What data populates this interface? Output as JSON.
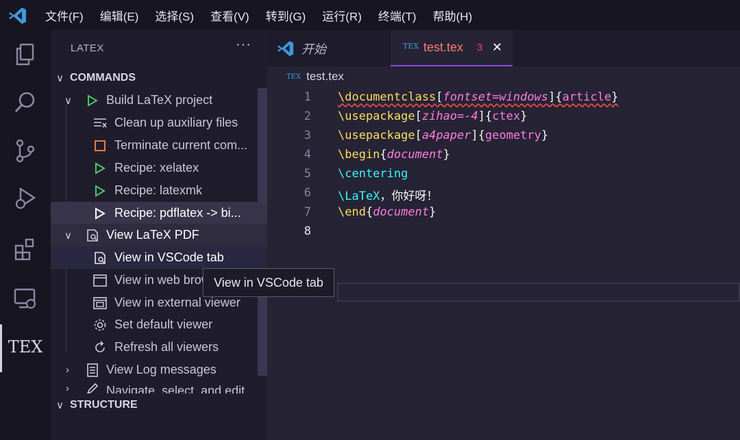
{
  "menu": [
    "文件(F)",
    "编辑(E)",
    "选择(S)",
    "查看(V)",
    "转到(G)",
    "运行(R)",
    "终端(T)",
    "帮助(H)"
  ],
  "activity": {
    "tex_label": "TEX"
  },
  "sidebar": {
    "title": "LATEX",
    "more": "···",
    "commands_header": "COMMANDS",
    "structure_header": "STRUCTURE",
    "items": [
      {
        "label": "Build LaTeX project"
      },
      {
        "label": "Clean up auxiliary files"
      },
      {
        "label": "Terminate current com..."
      },
      {
        "label": "Recipe: xelatex"
      },
      {
        "label": "Recipe: latexmk"
      },
      {
        "label": "Recipe: pdflatex -> bi..."
      },
      {
        "label": "View LaTeX PDF"
      },
      {
        "label": "View in VSCode tab"
      },
      {
        "label": "View in web browser"
      },
      {
        "label": "View in external viewer"
      },
      {
        "label": "Set default viewer"
      },
      {
        "label": "Refresh all viewers"
      },
      {
        "label": "View Log messages"
      },
      {
        "label": "Navigate, select, and edit"
      }
    ]
  },
  "tooltip": "View in VSCode tab",
  "tabs": {
    "start": "开始",
    "active": "test.tex",
    "active_problems": "3",
    "close": "✕"
  },
  "breadcrumb": "test.tex",
  "code": {
    "line_numbers": [
      "1",
      "2",
      "3",
      "4",
      "5",
      "6",
      "7",
      "8"
    ],
    "l1": {
      "cmd": "\\documentclass",
      "lb": "[",
      "opt": "fontset=windows",
      "rb": "]",
      "lc": "{",
      "arg": "article",
      "rc": "}"
    },
    "l2": {
      "cmd": "\\usepackage",
      "lb": "[",
      "opt": "zihao=-4",
      "rb": "]",
      "lc": "{",
      "arg": "ctex",
      "rc": "}"
    },
    "l3": {
      "cmd": "\\usepackage",
      "lb": "[",
      "opt": "a4paper",
      "rb": "]",
      "lc": "{",
      "arg": "geometry",
      "rc": "}"
    },
    "l4": {
      "cmd": "\\begin",
      "lc": "{",
      "arg": "document",
      "rc": "}"
    },
    "l5": {
      "cmd": "\\centering"
    },
    "l6": {
      "cmd": "\\LaTeX",
      "text": "，你好呀！"
    },
    "l7": {
      "cmd": "\\end",
      "lc": "{",
      "arg": "document",
      "rc": "}"
    }
  },
  "colors": {
    "background": "#262335",
    "keyword": "#fede5d",
    "command": "#36f9f6",
    "argument": "#ff7edb",
    "play_green": "#4cc66a",
    "stop_orange": "#f07a3e",
    "problem_red": "#f14c4c",
    "tab_accent": "#8f4bd4"
  }
}
